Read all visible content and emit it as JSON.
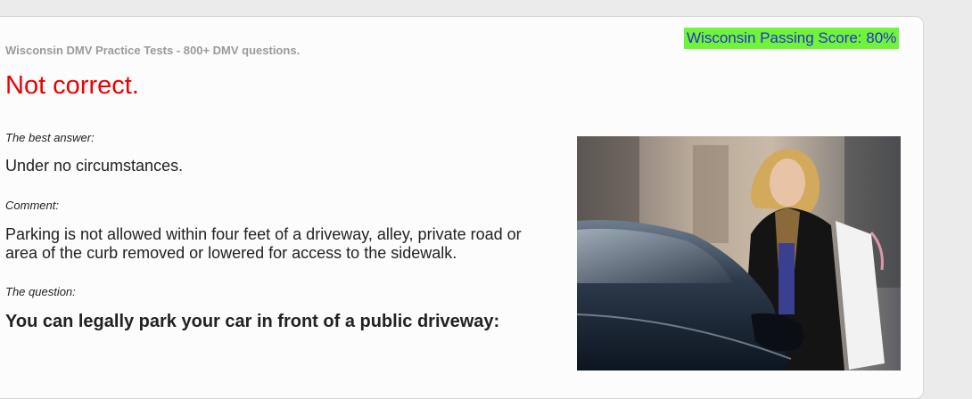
{
  "header": {
    "site_title": "Wisconsin DMV Practice Tests - 800+ DMV questions.",
    "passing_score": "Wisconsin Passing Score: 80%"
  },
  "result": {
    "status": "Not correct."
  },
  "answer": {
    "label": "The best answer:",
    "text": "Under no circumstances."
  },
  "comment": {
    "label": "Comment:",
    "text": "Parking is not allowed within four feet of a driveway, alley, private road or area of the curb removed or lowered for access to the sidewalk."
  },
  "question": {
    "label": "The question:",
    "text": "You can legally park your car in front of a public driveway:"
  },
  "colors": {
    "result": "#ee0000",
    "badge_bg": "#6ef53a",
    "badge_text": "#2b2bd1"
  }
}
